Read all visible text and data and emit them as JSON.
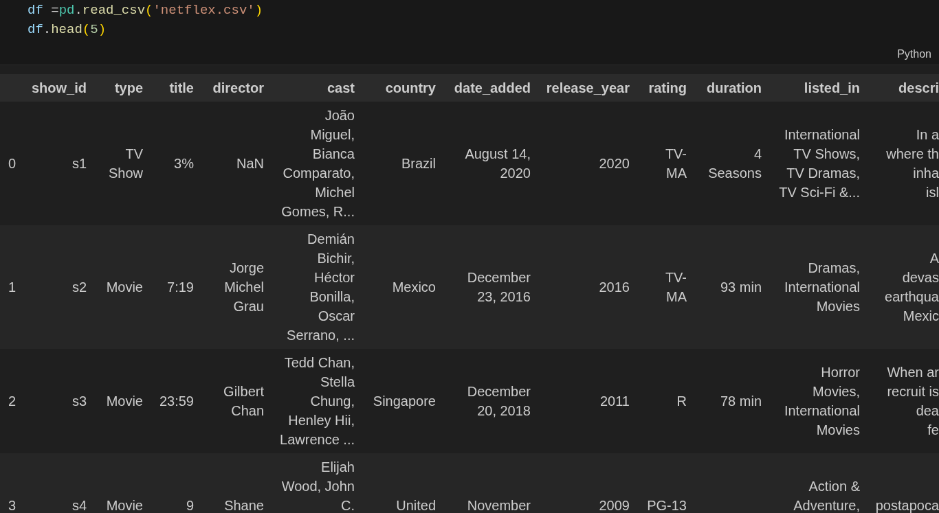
{
  "cell": {
    "code_lines": [
      [
        {
          "kind": "variable",
          "text": "df"
        },
        {
          "kind": "operator",
          "text": " ="
        },
        {
          "kind": "module",
          "text": "pd"
        },
        {
          "kind": "punct",
          "text": "."
        },
        {
          "kind": "function",
          "text": "read_csv"
        },
        {
          "kind": "bracket",
          "text": "("
        },
        {
          "kind": "string",
          "text": "'netflex.csv'"
        },
        {
          "kind": "bracket",
          "text": ")"
        }
      ],
      [
        {
          "kind": "variable",
          "text": "df"
        },
        {
          "kind": "punct",
          "text": "."
        },
        {
          "kind": "function",
          "text": "head"
        },
        {
          "kind": "bracket",
          "text": "("
        },
        {
          "kind": "number",
          "text": "5"
        },
        {
          "kind": "bracket",
          "text": ")"
        }
      ]
    ],
    "language": "Python"
  },
  "table": {
    "columns": [
      "",
      "show_id",
      "type",
      "title",
      "director",
      "cast",
      "country",
      "date_added",
      "release_year",
      "rating",
      "duration",
      "listed_in",
      "descri"
    ],
    "rows": [
      {
        "cells": [
          "0",
          "s1",
          "TV Show",
          "3%",
          "NaN",
          "João Miguel, Bianca Comparato, Michel Gomes, R...",
          "Brazil",
          "August 14, 2020",
          "2020",
          "TV-MA",
          "4 Seasons",
          "International TV Shows, TV Dramas, TV Sci-Fi &...",
          "In a\nwhere th\ninha\nisl"
        ]
      },
      {
        "cells": [
          "1",
          "s2",
          "Movie",
          "7:19",
          "Jorge Michel Grau",
          "Demián Bichir, Héctor Bonilla, Oscar Serrano, ...",
          "Mexico",
          "December 23, 2016",
          "2016",
          "TV-MA",
          "93 min",
          "Dramas, International Movies",
          "A\ndevas\nearthqua\nMexic"
        ]
      },
      {
        "cells": [
          "2",
          "s3",
          "Movie",
          "23:59",
          "Gilbert Chan",
          "Tedd Chan, Stella Chung, Henley Hii, Lawrence ...",
          "Singapore",
          "December 20, 2018",
          "2011",
          "R",
          "78 min",
          "Horror Movies, International Movies",
          "When ar\nrecruit is\ndea\nfe"
        ]
      },
      {
        "partial": true,
        "cells": [
          "3",
          "s4",
          "Movie",
          "9",
          "Shane",
          "Elijah Wood, John C.",
          "United",
          "November",
          "2009",
          "PG-13",
          "",
          "Action & Adventure,",
          "postapoca"
        ]
      }
    ]
  }
}
